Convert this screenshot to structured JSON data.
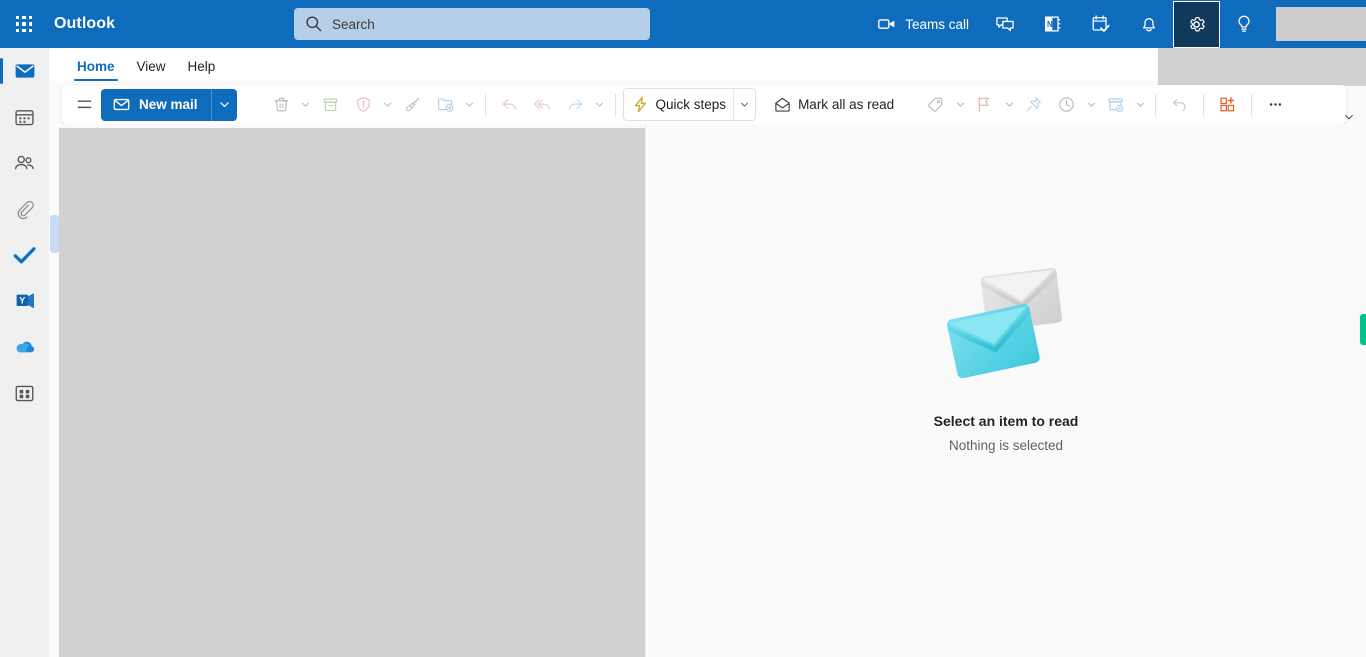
{
  "app": {
    "brand": "Outlook",
    "accent": "#0f6cbd",
    "accent_dark": "#11395c",
    "placeholder_gray": "#d1d1d1",
    "green_accent": "#00c389"
  },
  "topbar": {
    "waffle_label": "app-launcher",
    "search": {
      "placeholder": "Search",
      "value": "",
      "icon": "search-icon"
    },
    "right_items": [
      {
        "name": "teams-call",
        "icon": "video-camera-icon",
        "label": "Teams call",
        "labeled": true,
        "active": false
      },
      {
        "name": "teams-chat",
        "icon": "chat-icon",
        "label": "",
        "labeled": false,
        "active": false
      },
      {
        "name": "office-notes",
        "icon": "onenote-icon",
        "label": "",
        "labeled": false,
        "active": false
      },
      {
        "name": "to-do",
        "icon": "task-check-icon",
        "label": "",
        "labeled": false,
        "active": false
      },
      {
        "name": "notifications",
        "icon": "bell-icon",
        "label": "",
        "labeled": false,
        "active": false
      },
      {
        "name": "settings",
        "icon": "gear-icon",
        "label": "",
        "labeled": false,
        "active": true
      },
      {
        "name": "tips",
        "icon": "lightbulb-icon",
        "label": "",
        "labeled": false,
        "active": false
      }
    ],
    "avatar_label": "account-avatar"
  },
  "ribbon": {
    "tabs": [
      {
        "label": "Home",
        "selected": true
      },
      {
        "label": "View",
        "selected": false
      },
      {
        "label": "Help",
        "selected": false
      }
    ],
    "collapse_icon": "chevron-down-icon"
  },
  "toolbar": {
    "menu_icon": "hamburger-menu-icon",
    "new_mail_label": "New mail",
    "new_mail_icon": "envelope-icon",
    "new_mail_caret_icon": "chevron-down-icon",
    "quick_steps_label": "Quick steps",
    "quick_steps_icon": "lightning-bolt-icon",
    "mark_all_read_label": "Mark all as read",
    "mark_all_read_icon": "open-envelope-icon",
    "commands": [
      {
        "name": "delete",
        "icon": "trash-icon",
        "caret": true
      },
      {
        "name": "archive",
        "icon": "archive-box-icon",
        "caret": false
      },
      {
        "name": "report-junk",
        "icon": "shield-alert-icon",
        "caret": true
      },
      {
        "name": "sweep",
        "icon": "broom-icon",
        "caret": false
      },
      {
        "name": "move-to",
        "icon": "folder-arrow-icon",
        "caret": true
      },
      {
        "name": "reply",
        "icon": "reply-arrow-icon",
        "caret": false
      },
      {
        "name": "reply-all",
        "icon": "reply-all-arrow-icon",
        "caret": false
      },
      {
        "name": "forward",
        "icon": "forward-arrow-icon",
        "caret": true
      }
    ],
    "commands_right": [
      {
        "name": "categorize",
        "icon": "tag-icon",
        "caret": true
      },
      {
        "name": "flag",
        "icon": "flag-icon",
        "caret": true
      },
      {
        "name": "pin",
        "icon": "pin-icon",
        "caret": false
      },
      {
        "name": "snooze",
        "icon": "clock-icon",
        "caret": true
      },
      {
        "name": "rules",
        "icon": "rules-mail-icon",
        "caret": true
      }
    ],
    "commands_far_right": [
      {
        "name": "undo",
        "icon": "undo-arrow-icon",
        "caret": false
      },
      {
        "name": "add-apps",
        "icon": "apps-add-icon",
        "caret": false
      },
      {
        "name": "more-commands",
        "icon": "ellipsis-icon",
        "caret": false
      }
    ]
  },
  "rail": {
    "items": [
      {
        "name": "mail",
        "icon": "mail-icon",
        "selected": true
      },
      {
        "name": "calendar",
        "icon": "calendar-icon",
        "selected": false
      },
      {
        "name": "people",
        "icon": "people-icon",
        "selected": false
      },
      {
        "name": "files",
        "icon": "paperclip-icon",
        "selected": false
      },
      {
        "name": "to-do",
        "icon": "checkmark-icon",
        "selected": false
      },
      {
        "name": "yammer",
        "icon": "yammer-icon",
        "selected": false
      },
      {
        "name": "onedrive",
        "icon": "cloud-icon",
        "selected": false
      },
      {
        "name": "more-apps",
        "icon": "grid-apps-icon",
        "selected": false
      }
    ]
  },
  "message_list": {
    "state": "loading-placeholder",
    "resize_handle": "pane-resize-handle"
  },
  "reading_pane": {
    "illustration": "two-envelopes-illustration",
    "title": "Select an item to read",
    "subtitle": "Nothing is selected"
  },
  "edge_tab": {
    "name": "feedback-tab",
    "color": "#00c389"
  }
}
